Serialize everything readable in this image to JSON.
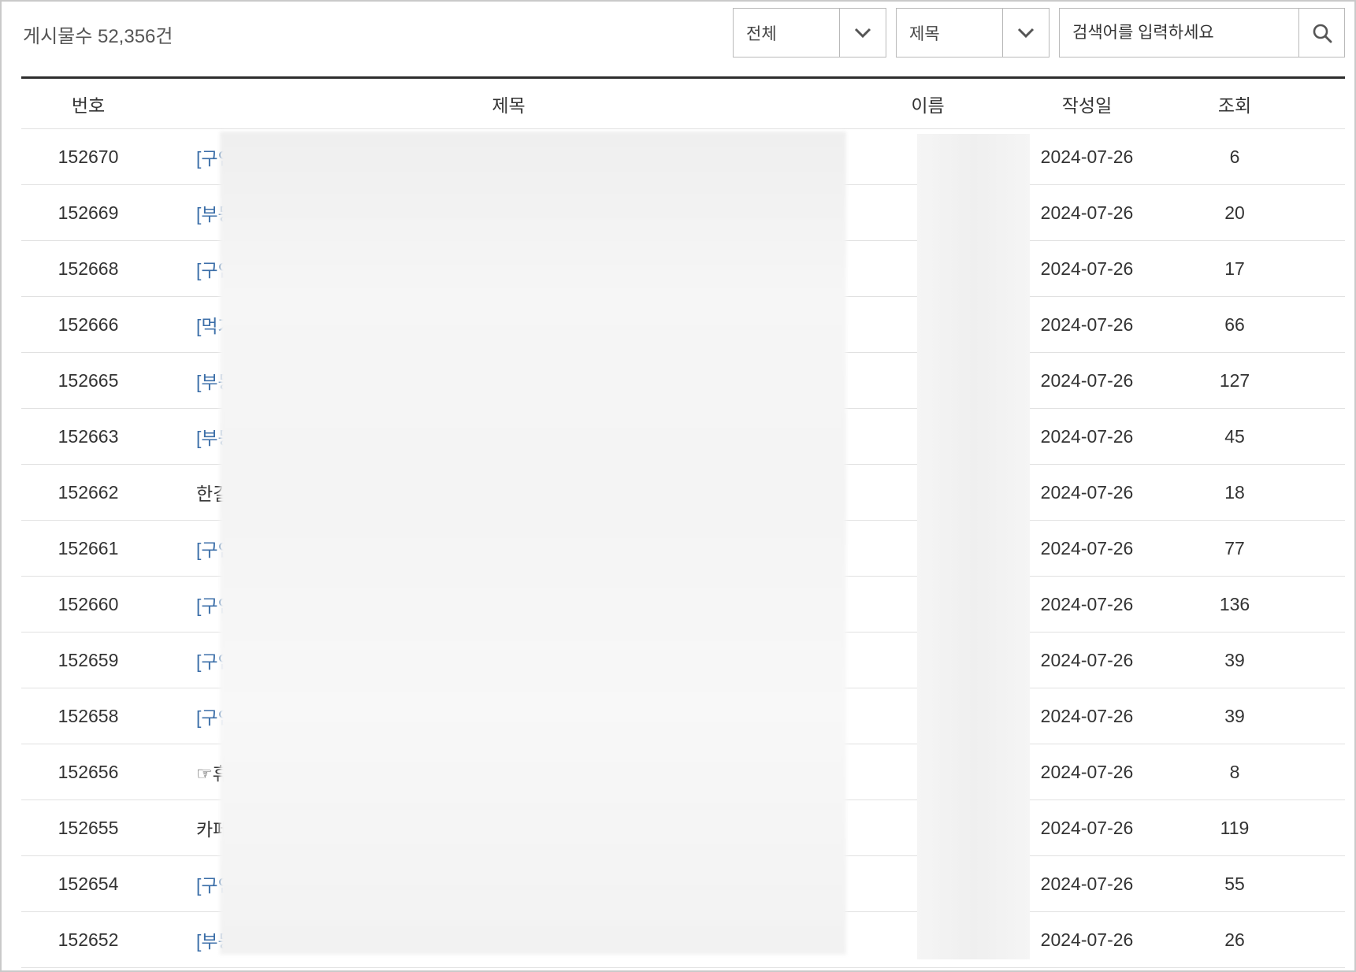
{
  "header": {
    "post_count": "게시물수 52,356건"
  },
  "filters": [
    {
      "value": "전체",
      "icon": "chevron-down-icon"
    },
    {
      "value": "제목",
      "icon": "chevron-down-icon"
    }
  ],
  "search": {
    "placeholder": "검색어를 입력하세요",
    "icon": "search-icon"
  },
  "columns": {
    "no": "번호",
    "title": "제목",
    "name": "이름",
    "date": "작성일",
    "views": "조회"
  },
  "rows": [
    {
      "no": "152670",
      "title": "[구인",
      "link": true,
      "date": "2024-07-26",
      "views": "6"
    },
    {
      "no": "152669",
      "title": "[부동",
      "link": true,
      "date": "2024-07-26",
      "views": "20"
    },
    {
      "no": "152668",
      "title": "[구인",
      "link": true,
      "date": "2024-07-26",
      "views": "17"
    },
    {
      "no": "152666",
      "title": "[먹거",
      "link": true,
      "date": "2024-07-26",
      "views": "66"
    },
    {
      "no": "152665",
      "title": "[부동",
      "link": true,
      "date": "2024-07-26",
      "views": "127"
    },
    {
      "no": "152663",
      "title": "[부동",
      "link": true,
      "date": "2024-07-26",
      "views": "45"
    },
    {
      "no": "152662",
      "title": "한길",
      "link": false,
      "date": "2024-07-26",
      "views": "18"
    },
    {
      "no": "152661",
      "title": "[구인",
      "link": true,
      "date": "2024-07-26",
      "views": "77"
    },
    {
      "no": "152660",
      "title": "[구인",
      "link": true,
      "date": "2024-07-26",
      "views": "136"
    },
    {
      "no": "152659",
      "title": "[구인",
      "link": true,
      "date": "2024-07-26",
      "views": "39"
    },
    {
      "no": "152658",
      "title": "[구인",
      "link": true,
      "date": "2024-07-26",
      "views": "39"
    },
    {
      "no": "152656",
      "title": "☞휴",
      "link": false,
      "date": "2024-07-26",
      "views": "8"
    },
    {
      "no": "152655",
      "title": "카페",
      "link": false,
      "date": "2024-07-26",
      "views": "119"
    },
    {
      "no": "152654",
      "title": "[구인",
      "link": true,
      "date": "2024-07-26",
      "views": "55"
    },
    {
      "no": "152652",
      "title": "[부동",
      "link": true,
      "date": "2024-07-26",
      "views": "26"
    }
  ]
}
